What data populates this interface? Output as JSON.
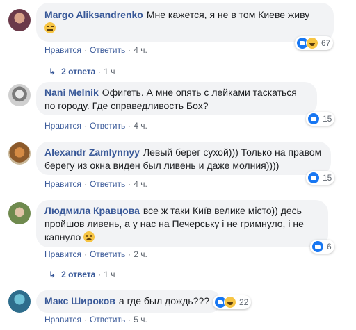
{
  "comments": [
    {
      "name": "Margo Aliksandrenko",
      "text": "Мне кажется, я не в том Киеве живу",
      "emoji": "expressionless",
      "like": "Нравится",
      "reply": "Ответить",
      "time": "4 ч.",
      "reaction_count": "67",
      "replies_label": "2 ответа",
      "replies_time": "1 ч"
    },
    {
      "name": "Nani Melnik",
      "text": "Офигеть. А мне опять с лейками таскаться по городу. Где справедливость Бох?",
      "like": "Нравится",
      "reply": "Ответить",
      "time": "4 ч.",
      "reaction_count": "15"
    },
    {
      "name": "Alexandr Zamlynnyy",
      "text": "Левый берег сухой))) Только на правом берегу из окна виден был ливень и даже молния))))",
      "like": "Нравится",
      "reply": "Ответить",
      "time": "4 ч.",
      "reaction_count": "15"
    },
    {
      "name": "Людмила Кравцова",
      "text": "все ж таки Київ велике місто)) десь пройшов ливень, а у нас на Печерську і не гримнуло, і не капнуло",
      "emoji": "sad",
      "like": "Нравится",
      "reply": "Ответить",
      "time": "2 ч.",
      "reaction_count": "6",
      "replies_label": "2 ответа",
      "replies_time": "1 ч"
    },
    {
      "name": "Макс Широков",
      "text": "а где был дождь???",
      "like": "Нравится",
      "reply": "Ответить",
      "time": "5 ч.",
      "reaction_count": "22"
    }
  ],
  "colors": {
    "name": "#385898",
    "bubble": "#f2f3f5",
    "like": "#1877f2",
    "haha": "#f7c544"
  }
}
